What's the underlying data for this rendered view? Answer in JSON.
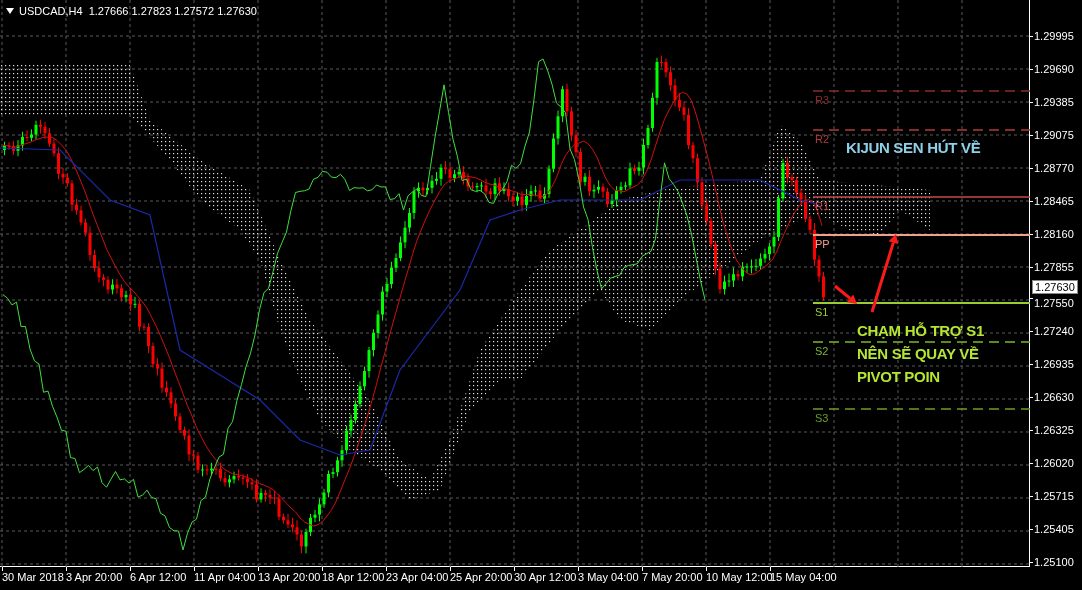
{
  "chart_header": {
    "text": "USDCAD,H4  1.27666 1.27823 1.27572 1.27630"
  },
  "price_axis": {
    "labels": [
      "1.29995",
      "1.29690",
      "1.29385",
      "1.29075",
      "1.28770",
      "1.28465",
      "1.28160",
      "1.27855",
      "1.27550",
      "1.27240",
      "1.26935",
      "1.26630",
      "1.26325",
      "1.26020",
      "1.25715",
      "1.25405",
      "1.25100"
    ],
    "current_price": "1.27630"
  },
  "time_axis": {
    "labels": [
      "30 Mar 2018",
      "3 Apr 20:00",
      "6 Apr 12:00",
      "11 Apr 04:00",
      "13 Apr 20:00",
      "18 Apr 12:00",
      "23 Apr 04:00",
      "25 Apr 20:00",
      "30 Apr 12:00",
      "3 May 04:00",
      "7 May 20:00",
      "10 May 12:00",
      "15 May 04:00"
    ]
  },
  "pivot_levels": [
    {
      "label": "R3",
      "color": "#8b2c2c",
      "kind": "dashed"
    },
    {
      "label": "R2",
      "color": "#b03a3a",
      "kind": "dashed"
    },
    {
      "label": "R1",
      "color": "#c84848",
      "kind": "solid"
    },
    {
      "label": "PP",
      "color": "#f0a08c",
      "kind": "solid"
    },
    {
      "label": "S1",
      "color": "#9acd32",
      "kind": "solid"
    },
    {
      "label": "S2",
      "color": "#7cb82a",
      "kind": "dashed"
    },
    {
      "label": "S3",
      "color": "#6a9e24",
      "kind": "dashed"
    }
  ],
  "annotations": [
    {
      "lines": [
        "KIJUN SEN HÚT VỀ"
      ],
      "color": "#8fd0e8"
    },
    {
      "lines": [
        "CHẠM HỖ TRỢ S1",
        "NÊN SẼ QUAY VỀ",
        "PIVOT POIN"
      ],
      "color": "#b4e632"
    }
  ]
}
